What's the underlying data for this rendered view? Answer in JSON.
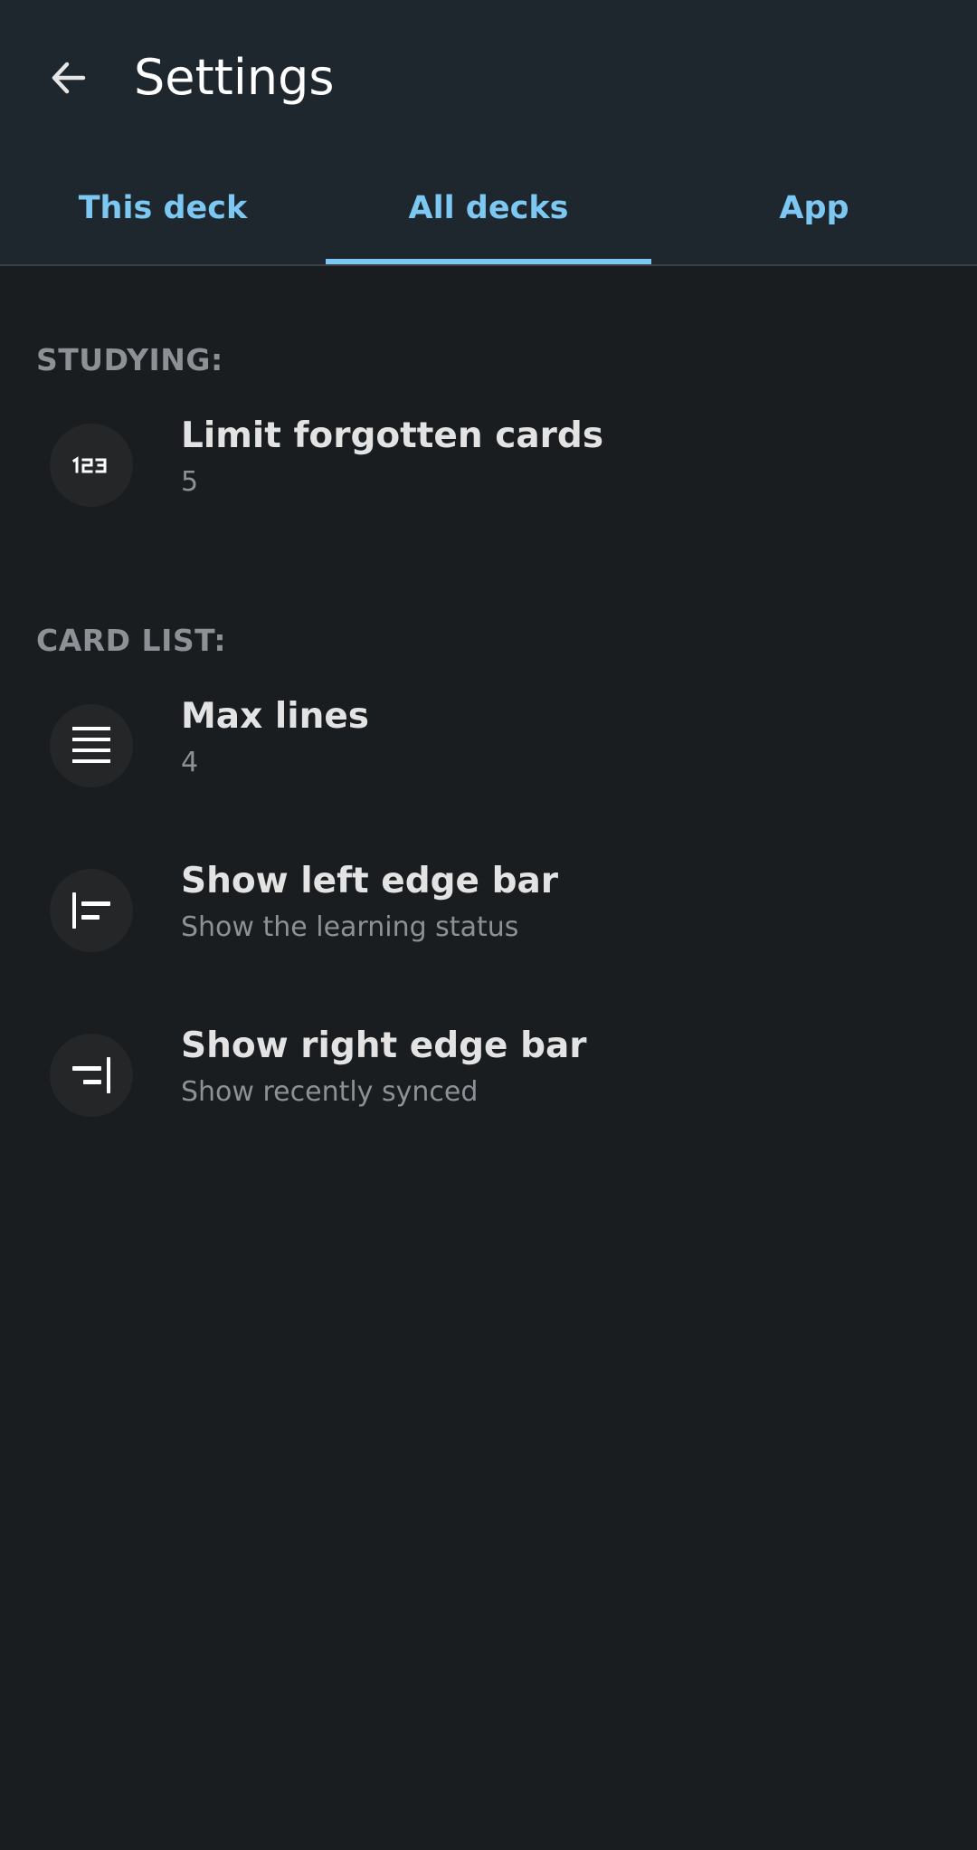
{
  "header": {
    "title": "Settings",
    "back_icon": "arrow-left-icon"
  },
  "tabs": [
    {
      "label": "This deck",
      "active": false
    },
    {
      "label": "All decks",
      "active": true
    },
    {
      "label": "App",
      "active": false
    }
  ],
  "sections": {
    "studying": {
      "header": "STUDYING:",
      "items": [
        {
          "icon": "numbers-123-icon",
          "title": "Limit forgotten cards",
          "value": "5"
        }
      ]
    },
    "card_list": {
      "header": "CARD LIST:",
      "items": [
        {
          "icon": "lines-icon",
          "title": "Max lines",
          "value": "4"
        },
        {
          "icon": "left-edge-bar-icon",
          "title": "Show left edge bar",
          "value": "Show the learning status"
        },
        {
          "icon": "right-edge-bar-icon",
          "title": "Show right edge bar",
          "value": "Show recently synced"
        }
      ]
    }
  },
  "colors": {
    "background": "#191d20",
    "toolbar": "#1f272e",
    "accent": "#7cc8f2",
    "icon_circle": "#242627",
    "primary_text": "#e3e3e3",
    "secondary_text": "#8d9195"
  }
}
